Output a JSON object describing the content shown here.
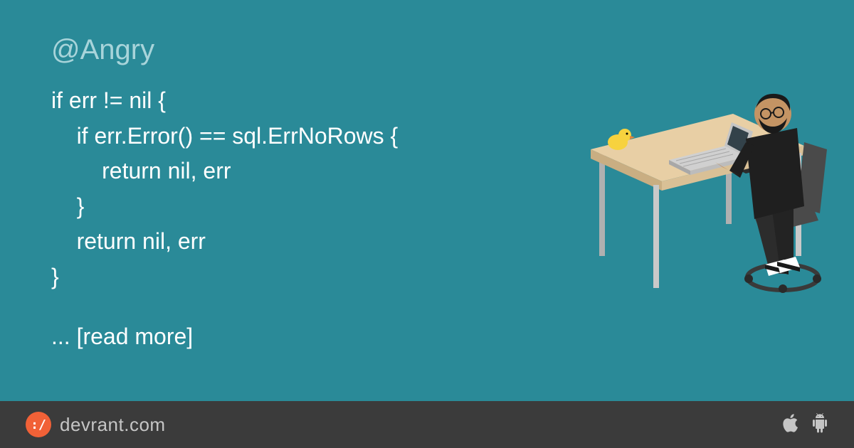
{
  "post": {
    "handle": "@Angry",
    "code": "if err != nil {\n    if err.Error() == sql.ErrNoRows {\n        return nil, err\n    }\n    return nil, err\n}",
    "read_more": "... [read more]"
  },
  "footer": {
    "logo_text": ":/",
    "brand": "devrant.com"
  }
}
